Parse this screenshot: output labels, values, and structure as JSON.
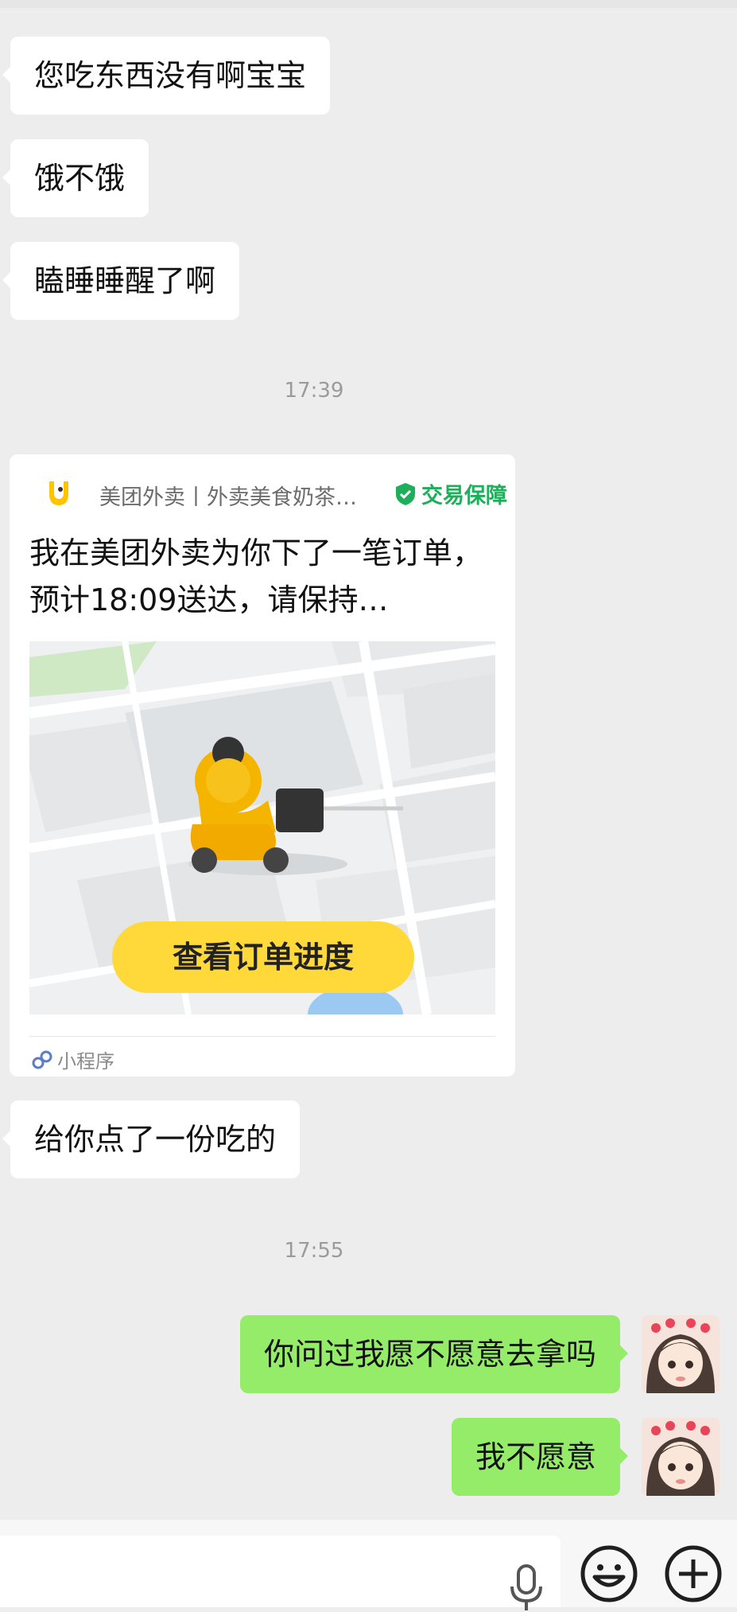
{
  "messages": [
    {
      "side": "in",
      "text": "您吃东西没有啊宝宝"
    },
    {
      "side": "in",
      "text": "饿不饿"
    },
    {
      "side": "in",
      "text": "瞌睡睡醒了啊"
    },
    {
      "side": "time",
      "text": "17:39"
    },
    {
      "side": "in",
      "text": "给你点了一份吃的"
    },
    {
      "side": "time",
      "text": "17:55"
    },
    {
      "side": "out",
      "text": "你问过我愿不愿意去拿吗"
    },
    {
      "side": "out",
      "text": "我不愿意"
    }
  ],
  "card": {
    "source": "美团外卖丨外卖美食奶茶…",
    "guarantee": "交易保障",
    "description": "我在美团外卖为你下了一笔订单，预计18:09送达，请保持…",
    "button": "查看订单进度",
    "footer": "小程序"
  },
  "colors": {
    "background": "#ededed",
    "bubble_in": "#ffffff",
    "bubble_out": "#95ec69",
    "accent_yellow": "#ffd83a",
    "guarantee_green": "#1fae5a"
  },
  "icons": {
    "voice": "microphone-icon",
    "emoji": "emoji-icon",
    "more": "plus-circle-icon",
    "logo": "meituan-kangaroo-logo",
    "mini_program": "mini-program-icon",
    "shield": "shield-check-icon"
  }
}
